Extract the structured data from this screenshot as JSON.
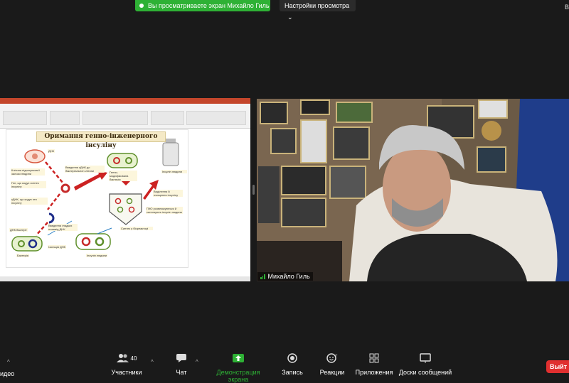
{
  "top": {
    "share_banner": "Вы просматриваете экран Михайло Гиль",
    "view_options": "Настройки просмотра",
    "view_options_caret": "⌄",
    "right_text": "В"
  },
  "shared_slide": {
    "title": "Оримання генно-інженерного інсуліну",
    "labels": [
      "ДНК",
      "Клітина підшлункової залози людини",
      "Ген, що кодує синтез інсуліну",
      "кДНК, що кодує ген інсуліну",
      "Введення кДНК до бактеріальної клітини",
      "Генно-модифікована бактерія",
      "Інсулін людини",
      "Виділення й очищення інсуліну",
      "ГМО розмножуються й синтезують інсулін людини",
      "ДНК бактерії",
      "Бактерія",
      "Ізоляція ДНК",
      "Введення гладких плазмід ДНК",
      "Синтез у біореакторі",
      "Інсулін людини"
    ]
  },
  "participant": {
    "name": "Михайло Гиль"
  },
  "toolbar": {
    "video_label": "идео",
    "participants_label": "Участники",
    "participants_count": "40",
    "chat_label": "Чат",
    "share_label": "Демонстрация экрана",
    "record_label": "Запись",
    "reactions_label": "Реакции",
    "apps_label": "Приложения",
    "whiteboards_label": "Доски сообщений",
    "leave_label": "Выйт"
  },
  "colors": {
    "share_green": "#2eb135",
    "leave_red": "#e02f2f",
    "background": "#1a1a1a"
  }
}
